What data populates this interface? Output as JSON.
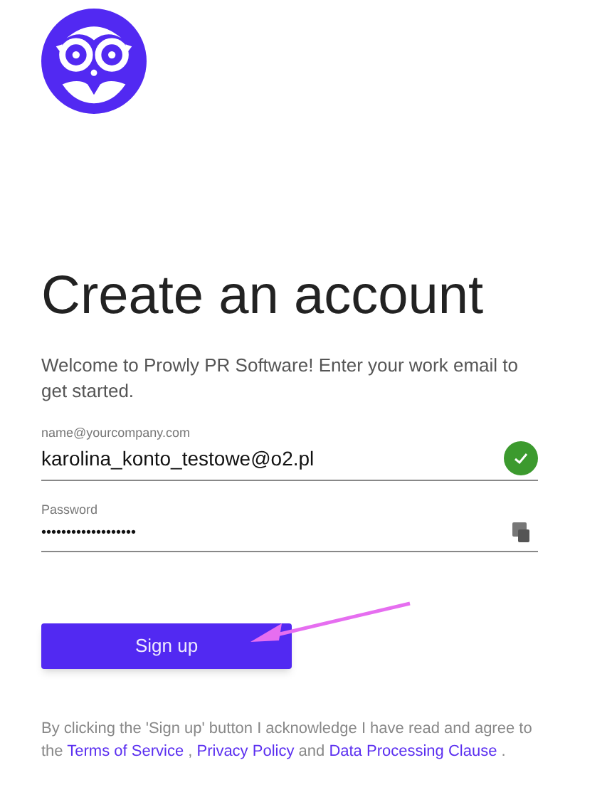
{
  "heading": "Create an account",
  "intro": "Welcome to Prowly PR Software! Enter your work email to get started.",
  "fields": [
    {
      "kind": "email",
      "label": "name@yourcompany.com",
      "value": "karolina_konto_testowe@o2.pl",
      "valid": true
    },
    {
      "kind": "password",
      "label": "Password",
      "value": "•••••••••••••••••••",
      "valid": false
    }
  ],
  "button": "Sign up",
  "consent": [
    {
      "kind": "text",
      "text": "By clicking the 'Sign up' button I acknowledge I have read and agree to the "
    },
    {
      "kind": "link",
      "text": "Terms of Service"
    },
    {
      "kind": "text",
      "text": " , "
    },
    {
      "kind": "link",
      "text": "Privacy Policy"
    },
    {
      "kind": "text",
      "text": " and "
    },
    {
      "kind": "link",
      "text": "Data Processing Clause"
    },
    {
      "kind": "text",
      "text": " ."
    }
  ]
}
